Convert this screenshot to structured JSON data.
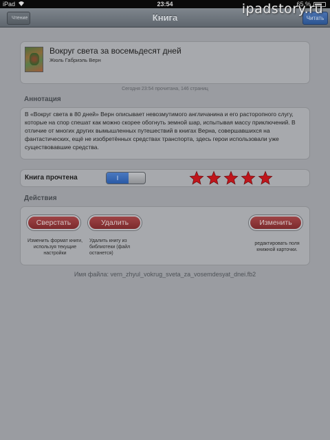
{
  "status_bar": {
    "device": "iPad",
    "time": "23:54",
    "battery": "65 %"
  },
  "watermark": "ipadstory.ru",
  "nav": {
    "back_label": "Чтение",
    "title": "Книга",
    "right_label": "Читать"
  },
  "book": {
    "title": "Вокруг света за восемьдесят дней",
    "author": "Жюль Габриэль Верн",
    "read_info": "Сегодня 23:54 прочитана, 146 страниц"
  },
  "annotation": {
    "header": "Аннотация",
    "text": "В «Вокруг света в 80 дней» Верн описывает невозмутимого англичанина и его расторопного слугу, которые на спор спешат как можно скорее обогнуть земной шар, испытывая массу приключений. В отличие от многих других вымышленных путешествий в книгах Верна, совершавшихся на фантастических, ещё не изобретённых средствах транспорта, здесь герои использовали уже существовавшие средства."
  },
  "read_status": {
    "label": "Книга прочтена",
    "toggle_on_text": "I",
    "is_read": true,
    "rating": 5,
    "rating_max": 5,
    "star_color": "#c0151b"
  },
  "actions": {
    "header": "Действия",
    "convert_label": "Сверстать",
    "convert_desc": "Изменить формат книги, используя текущие настройки",
    "delete_label": "Удалить",
    "delete_desc": "Удалить книгу из библиотеки (файл останется)",
    "edit_label": "Изменить",
    "edit_desc": "редактировать поля книжной карточки."
  },
  "file": {
    "filename": "Имя файла: vern_zhyul_vokrug_sveta_za_vosemdesyat_dnei.fb2"
  }
}
